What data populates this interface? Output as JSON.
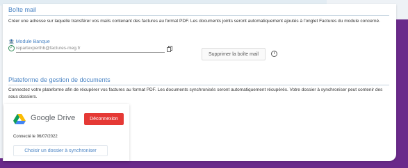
{
  "mailbox": {
    "title": "Boîte mail",
    "description": "Créer une adresse sur laquelle transférer vos mails contenant des factures au format PDF. Les documents joints seront automatiquement ajoutés à l'onglet Factures du module concerné.",
    "module_label": "Module Banque",
    "email_value": "repartexperthb@factures-meg.fr",
    "delete_label": "Supprimer la boîte mail",
    "icons": {
      "module": "bank-icon",
      "check": "check-circle-icon",
      "copy": "copy-icon",
      "info": "info-icon"
    }
  },
  "platform": {
    "title": "Plateforme de gestion de documents",
    "description": "Connectez votre plateforme afin de récupérer vos factures au format PDF. Les documents synchronisés seront automatiquement récupérés. Votre dossier à synchroniser peut contenir des sous dossiers.",
    "provider": {
      "name": "Google Drive",
      "disconnect_label": "Déconnexion",
      "connected_text": "Connecté le 06/07/2022",
      "sync_label": "Choisir un dossier à synchroniser",
      "icon": "google-drive-icon"
    }
  },
  "colors": {
    "accent": "#4a84c4",
    "danger": "#e53935",
    "brand_purple": "#6a2a8a"
  }
}
